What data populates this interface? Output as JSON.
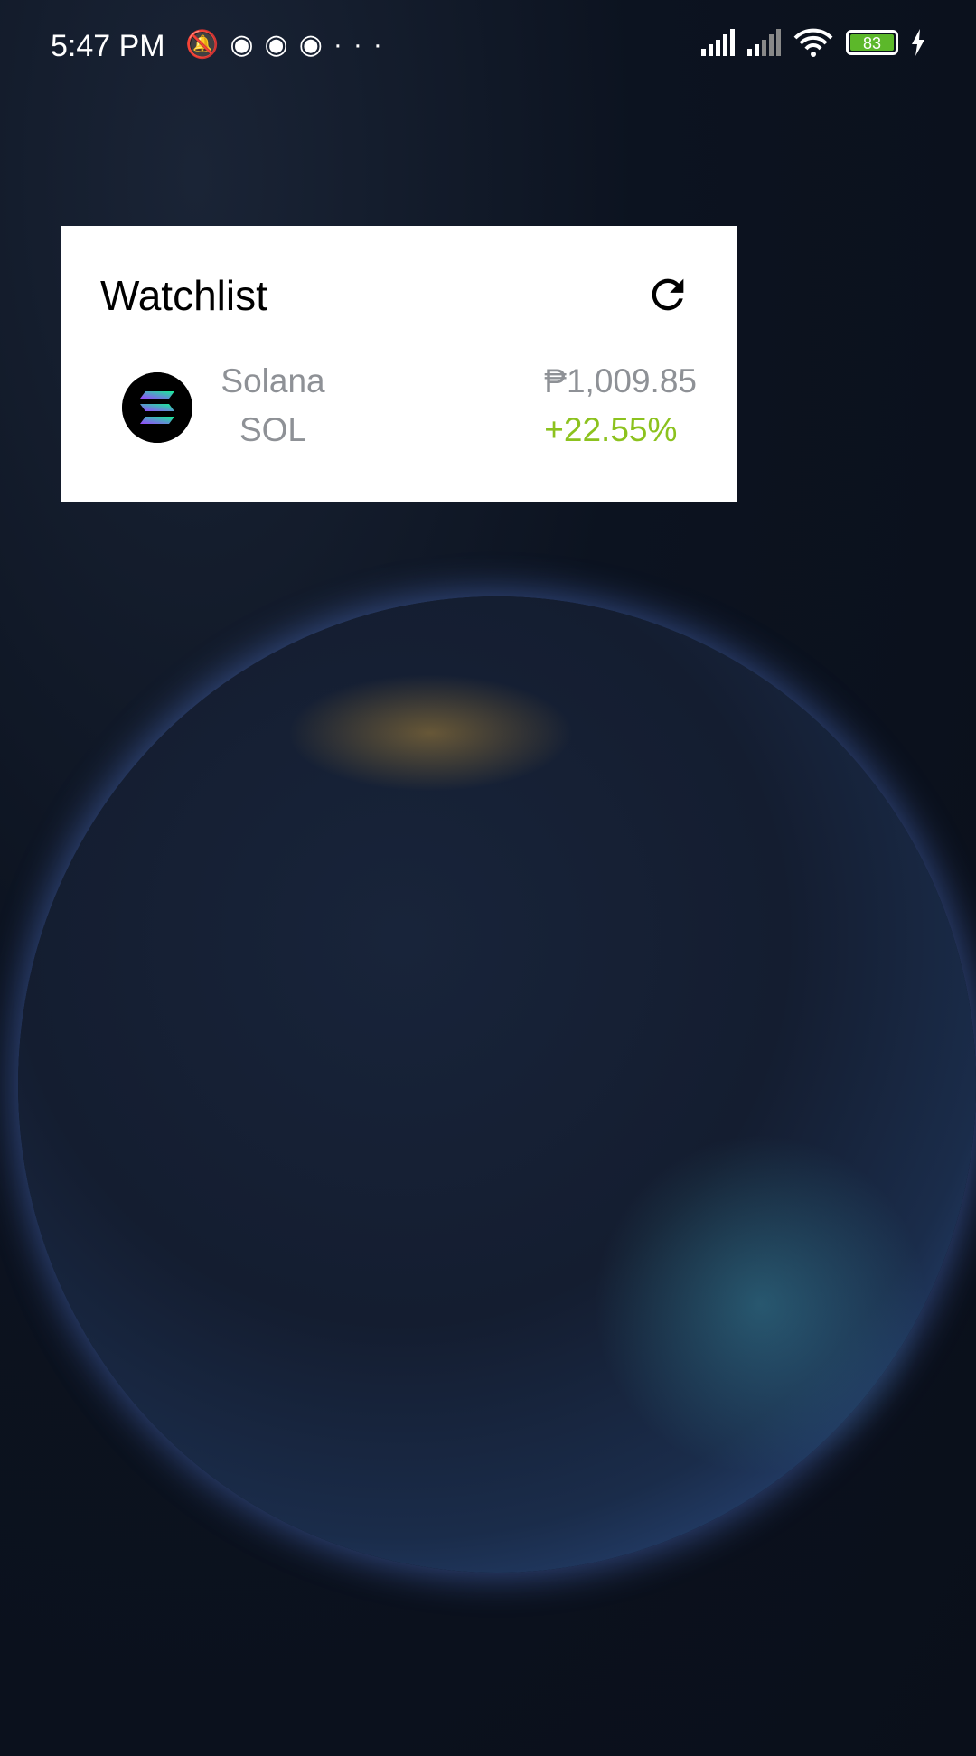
{
  "status_bar": {
    "time": "5:47 PM",
    "notification_icons": [
      "vibrate-off-icon",
      "discord-icon",
      "discord-icon",
      "discord-icon",
      "more-icon"
    ],
    "battery_level": "83",
    "charging": true
  },
  "widget": {
    "title": "Watchlist",
    "refresh_icon": "refresh-icon",
    "items": [
      {
        "name": "Solana",
        "symbol": "SOL",
        "price": "₱1,009.85",
        "change": "+22.55%",
        "change_color": "#8cc21e"
      }
    ]
  }
}
